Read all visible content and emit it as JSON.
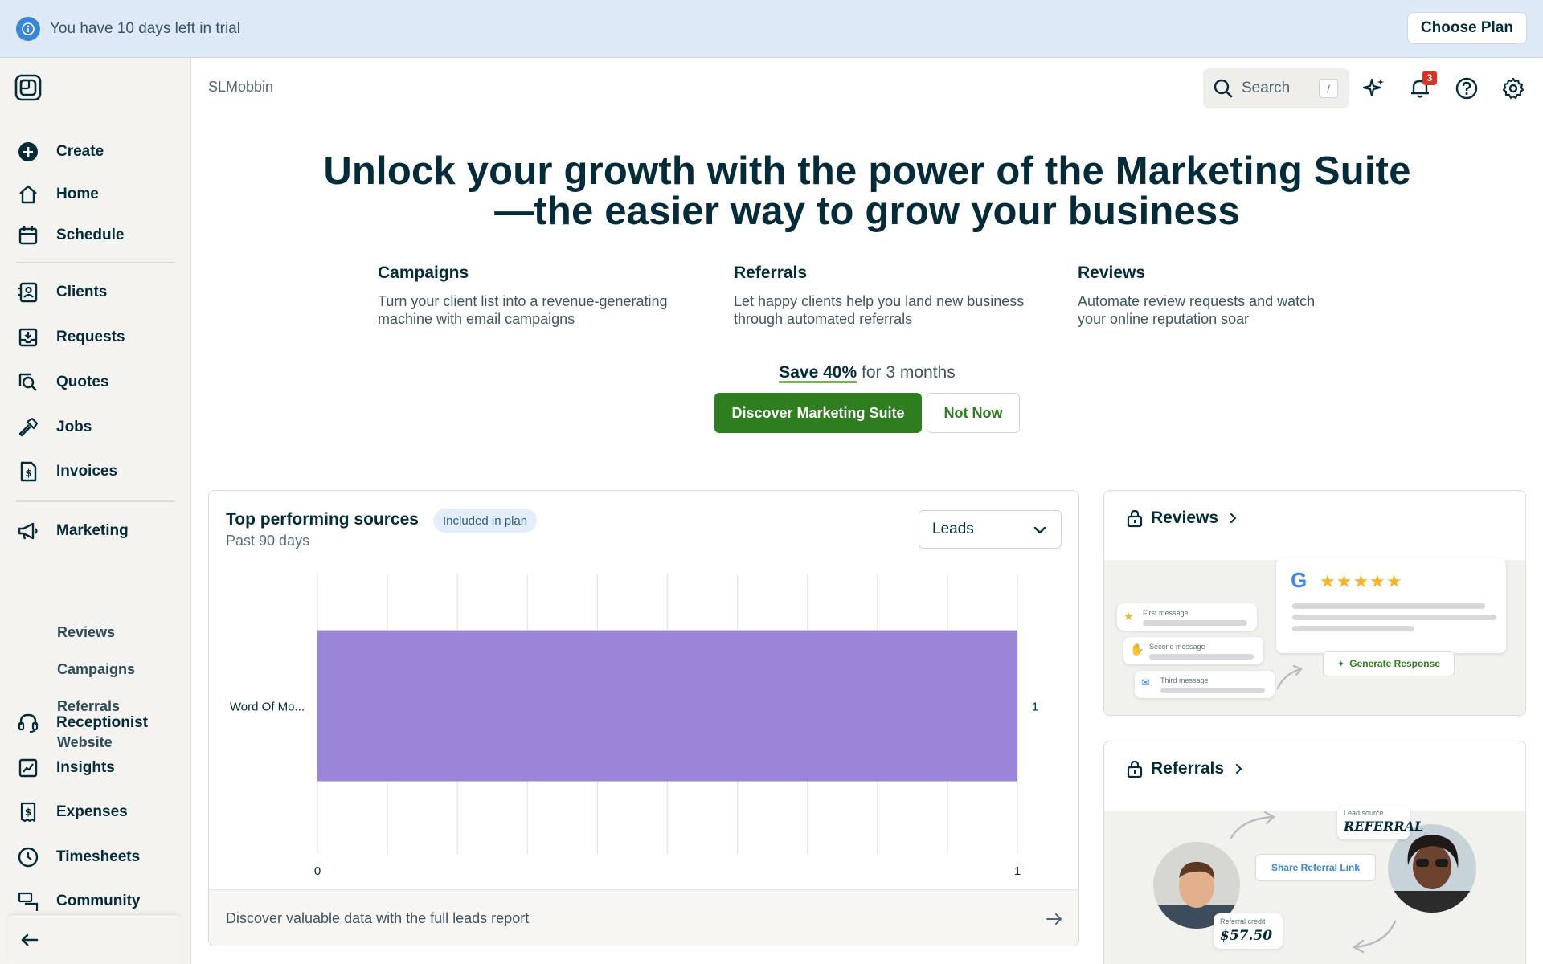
{
  "banner": {
    "trial_text": "You have 10 days left in trial",
    "choose_plan": "Choose Plan"
  },
  "sidebar": {
    "primary": [
      {
        "label": "Create",
        "icon": "plus-circle-icon"
      },
      {
        "label": "Home",
        "icon": "home-icon"
      },
      {
        "label": "Schedule",
        "icon": "calendar-icon"
      }
    ],
    "work": [
      {
        "label": "Clients",
        "icon": "contact-card-icon"
      },
      {
        "label": "Requests",
        "icon": "inbox-download-icon"
      },
      {
        "label": "Quotes",
        "icon": "quote-search-icon"
      },
      {
        "label": "Jobs",
        "icon": "hammer-icon"
      },
      {
        "label": "Invoices",
        "icon": "invoice-dollar-icon"
      }
    ],
    "marketing": {
      "label": "Marketing",
      "icon": "megaphone-icon",
      "sub": [
        "Reviews",
        "Campaigns",
        "Referrals",
        "Website"
      ]
    },
    "more": [
      {
        "label": "Receptionist",
        "icon": "headset-icon"
      },
      {
        "label": "Insights",
        "icon": "chart-icon"
      },
      {
        "label": "Expenses",
        "icon": "receipt-dollar-icon"
      },
      {
        "label": "Timesheets",
        "icon": "clock-icon"
      },
      {
        "label": "Community",
        "icon": "chat-icon"
      }
    ]
  },
  "topbar": {
    "breadcrumb": "SLMobbin",
    "search_label": "Search",
    "search_shortcut": "/",
    "notification_count": "3"
  },
  "hero": {
    "title_line1": "Unlock your growth with the power of the Marketing Suite",
    "title_line2": "—the easier way to grow your business",
    "features": [
      {
        "title": "Campaigns",
        "desc1": "Turn your client list into a revenue-generating",
        "desc2": "machine with email campaigns"
      },
      {
        "title": "Referrals",
        "desc1": "Let happy clients help you land new business",
        "desc2": "through automated referrals"
      },
      {
        "title": "Reviews",
        "desc1": "Automate review requests and watch",
        "desc2": "your online reputation soar"
      }
    ],
    "save_strong": "Save 40%",
    "save_rest": " for 3 months",
    "discover_label": "Discover Marketing Suite",
    "not_now_label": "Not Now"
  },
  "chart_card": {
    "title": "Top performing sources",
    "pill": "Included in plan",
    "subtitle": "Past 90 days",
    "select_value": "Leads",
    "footer_text": "Discover valuable data with the full leads report"
  },
  "chart_data": {
    "type": "bar",
    "orientation": "horizontal",
    "categories": [
      "Word Of Mo..."
    ],
    "values": [
      1
    ],
    "value_labels": [
      "1"
    ],
    "xlim": [
      0,
      1
    ],
    "x_ticks": [
      "0",
      "1"
    ],
    "grid": true,
    "bar_color": "#9b85d9"
  },
  "reviews_card": {
    "label": "Reviews",
    "messages": [
      "First message",
      "Second message",
      "Third message"
    ],
    "stars": "★★★★★",
    "generate_label": "Generate Response"
  },
  "referrals_card": {
    "label": "Referrals",
    "lead_source_label": "Lead source",
    "lead_source_value": "REFERRAL",
    "share_label": "Share Referral Link",
    "credit_label": "Referral credit",
    "credit_value": "$57.50"
  },
  "colors": {
    "brand_green": "#2e7d1f",
    "navy_text": "#032b3a",
    "bar_purple": "#9b85d9",
    "banner_blue": "#dde9f7"
  }
}
